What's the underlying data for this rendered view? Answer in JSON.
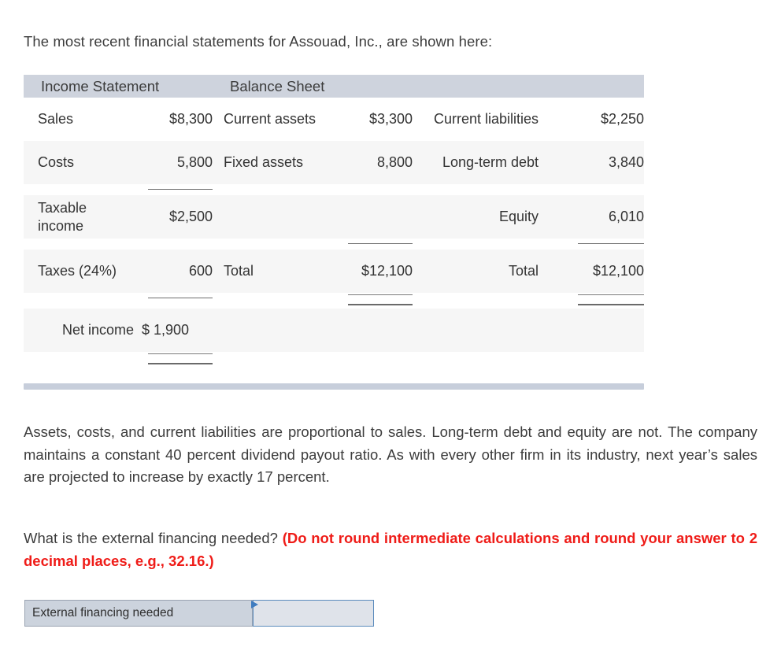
{
  "intro": {
    "text": "The most recent financial statements for Assouad, Inc., are shown here:"
  },
  "statement_table": {
    "headers": {
      "income_statement": "Income Statement",
      "balance_sheet": "Balance Sheet"
    },
    "rows": [
      {
        "is_label": "Sales",
        "is_value": "$8,300",
        "ba_label": "Current assets",
        "ba_value": "$3,300",
        "bl_label": "Current liabilities",
        "bl_value": "$2,250"
      },
      {
        "is_label": "Costs",
        "is_value": "5,800",
        "ba_label": "Fixed assets",
        "ba_value": "8,800",
        "bl_label": "Long-term debt",
        "bl_value": "3,840"
      },
      {
        "is_label": "Taxable income",
        "is_value": "$2,500",
        "ba_label": "",
        "ba_value": "",
        "bl_label": "Equity",
        "bl_value": "6,010"
      },
      {
        "is_label": "Taxes (24%)",
        "is_value": "600",
        "ba_label": "Total",
        "ba_value": "$12,100",
        "bl_label": "Total",
        "bl_value": "$12,100"
      },
      {
        "is_label": "Net income",
        "is_value": "$ 1,900",
        "ba_label": "",
        "ba_value": "",
        "bl_label": "",
        "bl_value": ""
      }
    ]
  },
  "assumptions": {
    "text": "Assets, costs, and current liabilities are proportional to sales. Long-term debt and equity are not. The company maintains a constant 40 percent dividend payout ratio. As with every other firm in its industry, next year’s sales are projected to increase by exactly 17 percent."
  },
  "question": {
    "prompt": "What is the external financing needed?",
    "instruction": "(Do not round intermediate calculations and round your answer to 2 decimal places, e.g., 32.16.)"
  },
  "answer": {
    "label": "External financing needed",
    "value": "",
    "placeholder": ""
  },
  "colors": {
    "header_bar": "#ced3dd",
    "separator_bar": "#c7cedb",
    "instruction_red": "#ef1c18",
    "input_border": "#5b8bbd",
    "input_fill": "#dfe3ea",
    "label_fill": "#ccd3dd"
  }
}
